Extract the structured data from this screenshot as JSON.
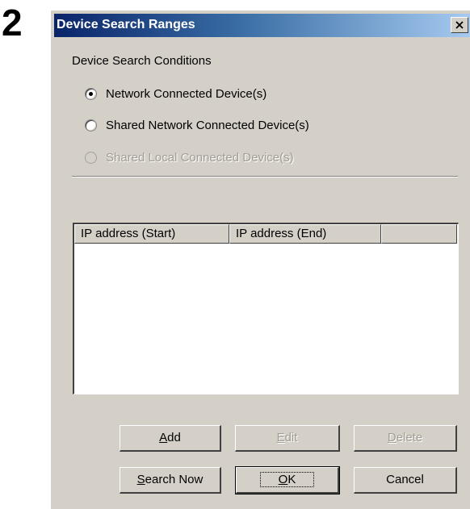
{
  "step_number": "2",
  "dialog": {
    "title": "Device Search Ranges",
    "close_glyph": "×",
    "group_label": "Device Search Conditions",
    "radios": [
      {
        "label": "Network Connected Device(s)",
        "checked": true,
        "enabled": true
      },
      {
        "label": "Shared Network Connected Device(s)",
        "checked": false,
        "enabled": true
      },
      {
        "label": "Shared Local Connected Device(s)",
        "checked": false,
        "enabled": false
      }
    ],
    "list_columns": [
      "IP address (Start)",
      "IP address (End)",
      ""
    ],
    "buttons": {
      "add": {
        "mnemonic": "A",
        "rest": "dd",
        "enabled": true
      },
      "edit": {
        "mnemonic": "E",
        "rest": "dit",
        "enabled": false
      },
      "delete": {
        "mnemonic": "D",
        "rest": "elete",
        "enabled": false
      },
      "search_now": {
        "mnemonic": "S",
        "rest": "earch Now",
        "enabled": true
      },
      "ok": {
        "mnemonic": "O",
        "rest": "K",
        "enabled": true,
        "default": true
      },
      "cancel": {
        "label": "Cancel",
        "enabled": true
      }
    }
  },
  "colors": {
    "titlebar_start": "#0a246a",
    "titlebar_end": "#a6caf0",
    "dialog_face": "#d4d0c8",
    "disabled_text": "#a19d94"
  }
}
